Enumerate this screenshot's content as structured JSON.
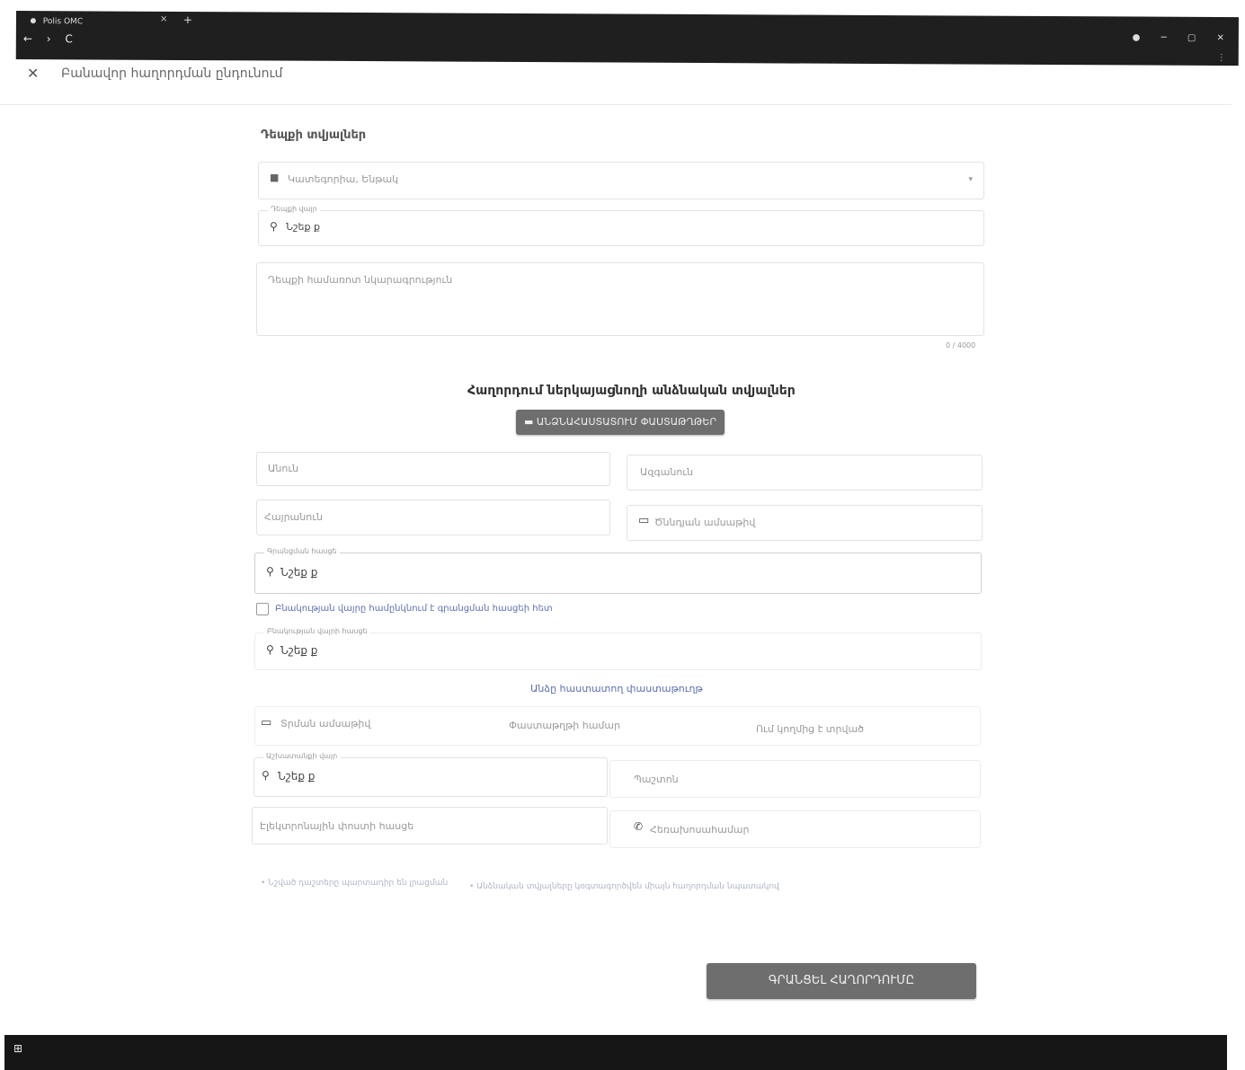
{
  "browser": {
    "tab_title": "Polis OMC",
    "tab_close": "×",
    "new_tab": "+",
    "back": "←",
    "forward": "›",
    "reload": "C",
    "window_controls": [
      "●",
      "─",
      "▢",
      "✕"
    ],
    "menu": "⋮"
  },
  "header": {
    "close_icon": "✕",
    "title": "Բանավոր հաղորդման ընդունում"
  },
  "event": {
    "section_title": "Դեպքի տվյալներ",
    "category_placeholder": "Կատեգորիա, Ենթակ",
    "address_label": "Դեպքի վայր",
    "address_value": "Նշեք ք",
    "description_placeholder": "Դեպքի համառոտ նկարագրություն",
    "char_count": "0 / 4000"
  },
  "reporter": {
    "heading": "Հաղորդում ներկայացնողի անձնական տվյալներ",
    "identify_button": "ԱՆՁՆԱՀԱՍՏԱՏՈՒՄ ՓԱՍՏԱԹՂԹԵՐ",
    "first_name_placeholder": "Անուն",
    "last_name_placeholder": "Ազգանուն",
    "patronymic_placeholder": "Հայրանուն",
    "birth_date_placeholder": "Ծննդյան ամսաթիվ",
    "registration_label": "Գրանցման հասցե",
    "registration_value": "Նշեք ք",
    "same_address_label": "Բնակության վայրը համընկնում է գրանցման հասցեի հետ",
    "residence_label": "Բնակության վայրի հասցե",
    "residence_value": "Նշեք ք",
    "document_link": "Անձը հաստատող փաստաթուղթ",
    "issue_date_placeholder": "Տրման ամսաթիվ",
    "doc_number_placeholder": "Փաստաթղթի համար",
    "issued_by_placeholder": "Ում կողմից է տրված",
    "work_label": "Աշխատանքի վայր",
    "work_value": "Նշեք ք",
    "position_placeholder": "Պաշտոն",
    "email_placeholder": "Էլեկտրոնային փոստի հասցե",
    "phone_placeholder": "Հեռախոսահամար"
  },
  "notes": {
    "note1": "Նշված դաշտերը պարտադիր են լրացման",
    "note2": "Անձնական տվյալները կօգտագործվեն միայն հաղորդման նպատակով"
  },
  "footer": {
    "submit_button": "ԳՐԱՆՑԵԼ ՀԱՂՈՐԴՈՒՄԸ"
  }
}
